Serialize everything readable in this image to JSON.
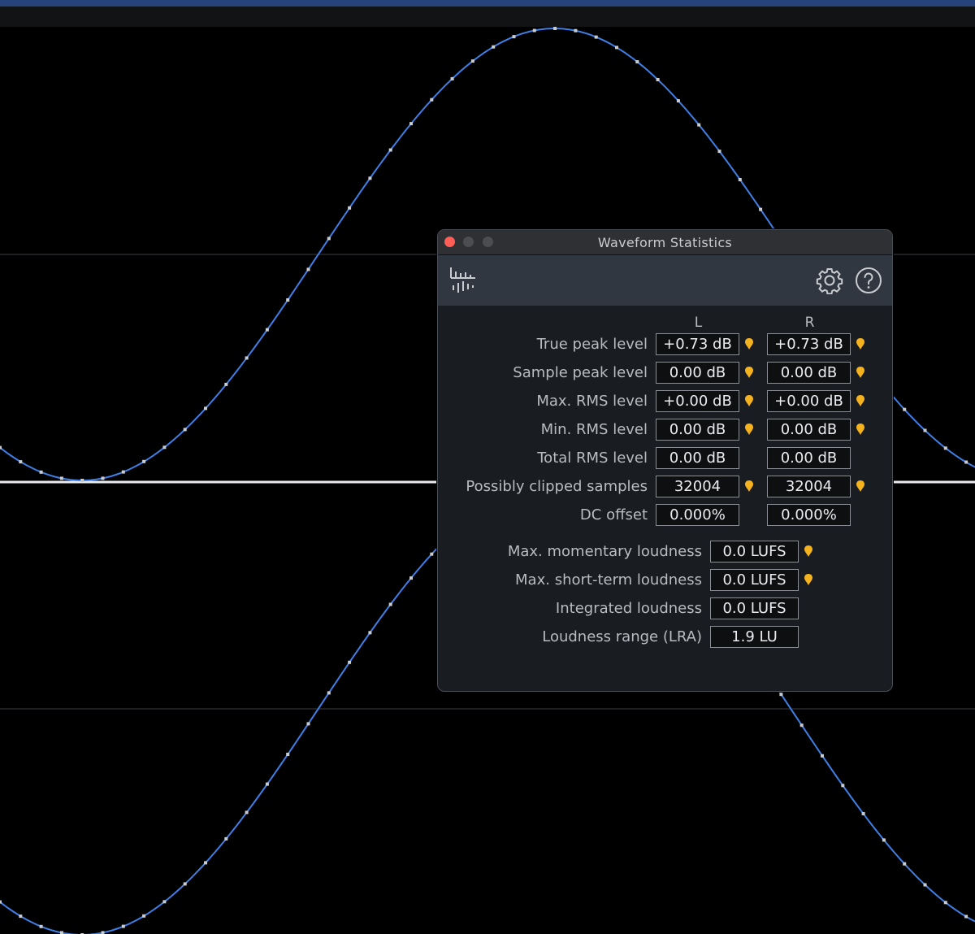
{
  "colors": {
    "waveform": "#3f7fe6",
    "sample_marker": "#c9ccd1",
    "pin": "#f5b21f",
    "accent_bar": "#26447a"
  },
  "dialog": {
    "title": "Waveform Statistics",
    "toolbar": {
      "left_icon": "waveform-stats-icon",
      "right_icons": [
        "gear-icon",
        "help-icon"
      ]
    },
    "columns": [
      "L",
      "R"
    ],
    "channel_stats": [
      {
        "label": "True peak level",
        "L": "+0.73 dB",
        "R": "+0.73 dB",
        "pin": true
      },
      {
        "label": "Sample peak level",
        "L": "0.00 dB",
        "R": "0.00 dB",
        "pin": true
      },
      {
        "label": "Max. RMS level",
        "L": "+0.00 dB",
        "R": "+0.00 dB",
        "pin": true
      },
      {
        "label": "Min. RMS level",
        "L": "0.00 dB",
        "R": "0.00 dB",
        "pin": true
      },
      {
        "label": "Total RMS level",
        "L": "0.00 dB",
        "R": "0.00 dB",
        "pin": false
      },
      {
        "label": "Possibly clipped samples",
        "L": "32004",
        "R": "32004",
        "pin": true
      },
      {
        "label": "DC offset",
        "L": "0.000%",
        "R": "0.000%",
        "pin": false
      }
    ],
    "loudness_stats": [
      {
        "label": "Max. momentary loudness",
        "value": "0.0 LUFS",
        "pin": true
      },
      {
        "label": "Max. short-term loudness",
        "value": "0.0 LUFS",
        "pin": true
      },
      {
        "label": "Integrated loudness",
        "value": "0.0 LUFS",
        "pin": false
      },
      {
        "label": "Loudness range (LRA)",
        "value": "1.9 LU",
        "pin": false
      }
    ]
  }
}
